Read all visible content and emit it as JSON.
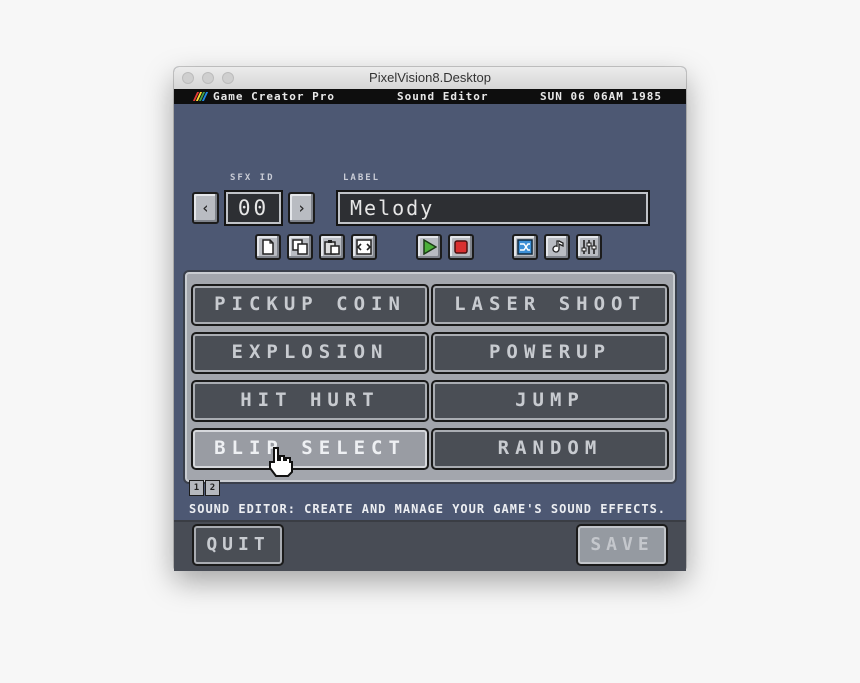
{
  "window": {
    "title": "PixelVision8.Desktop"
  },
  "menubar": {
    "app_name": "Game Creator Pro",
    "tool_name": "Sound Editor",
    "datetime": "SUN 06 06AM 1985"
  },
  "sfx": {
    "id_label": "SFX ID",
    "id_value": "00",
    "label_caption": "LABEL",
    "label_value": "Melody"
  },
  "toolbar": {
    "icons": [
      "new-file-icon",
      "copy-icon",
      "paste-icon",
      "revert-icon",
      "play-icon",
      "stop-icon",
      "mutate-icon",
      "wave-icon",
      "settings-sliders-icon"
    ]
  },
  "presets": {
    "items": [
      {
        "label": "PICKUP COIN"
      },
      {
        "label": "LASER SHOOT"
      },
      {
        "label": "EXPLOSION"
      },
      {
        "label": "POWERUP"
      },
      {
        "label": "HIT HURT"
      },
      {
        "label": "JUMP"
      },
      {
        "label": "BLIP SELECT"
      },
      {
        "label": "RANDOM"
      }
    ],
    "active_index": 6
  },
  "pages": {
    "tabs": [
      "1",
      "2"
    ]
  },
  "status": {
    "message": "SOUND EDITOR: CREATE AND MANAGE YOUR GAME'S SOUND EFFECTS."
  },
  "footer": {
    "quit_label": "QUIT",
    "save_label": "SAVE"
  },
  "colors": {
    "background": "#4d5873",
    "button": "#b9bcc2",
    "play_accent": "#4caf3a",
    "stop_accent": "#d93030",
    "mutate_accent": "#3d8fd6"
  }
}
